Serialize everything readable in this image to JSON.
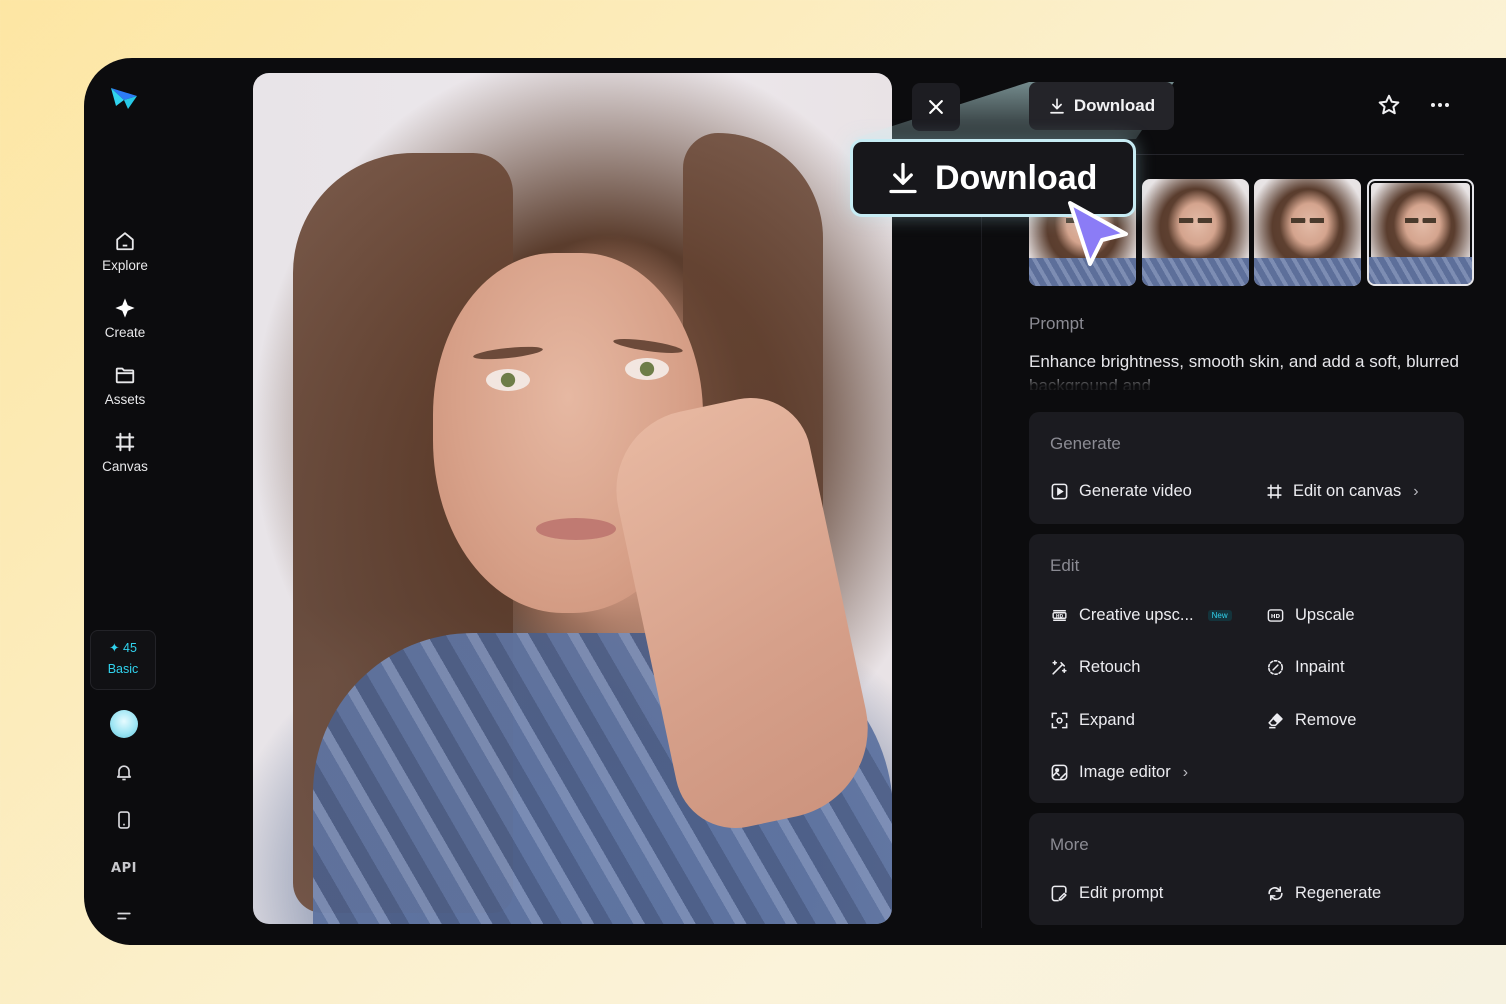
{
  "sidebar": {
    "nav": [
      {
        "label": "Explore",
        "icon": "home-icon"
      },
      {
        "label": "Create",
        "icon": "sparkle-icon"
      },
      {
        "label": "Assets",
        "icon": "folder-icon"
      },
      {
        "label": "Canvas",
        "icon": "canvas-icon"
      }
    ],
    "credits": {
      "amount": "45",
      "tier": "Basic"
    },
    "bottom": {
      "api_label": "API"
    }
  },
  "toolbar": {
    "download_label": "Download"
  },
  "callout": {
    "download_label": "Download"
  },
  "prompt": {
    "label": "Prompt",
    "text": "Enhance brightness, smooth skin, and add a soft, blurred background and"
  },
  "generate": {
    "title": "Generate",
    "actions": [
      {
        "label": "Generate video",
        "icon": "play-icon"
      },
      {
        "label": "Edit on canvas",
        "icon": "canvas-icon"
      }
    ]
  },
  "edit": {
    "title": "Edit",
    "actions": [
      {
        "label": "Creative upsc...",
        "icon": "hd-plus-icon",
        "badge": "New"
      },
      {
        "label": "Upscale",
        "icon": "hd-icon"
      },
      {
        "label": "Retouch",
        "icon": "wand-icon"
      },
      {
        "label": "Inpaint",
        "icon": "inpaint-icon"
      },
      {
        "label": "Expand",
        "icon": "expand-icon"
      },
      {
        "label": "Remove",
        "icon": "eraser-icon"
      },
      {
        "label": "Image editor",
        "icon": "image-editor-icon"
      }
    ]
  },
  "more": {
    "title": "More",
    "actions": [
      {
        "label": "Edit prompt",
        "icon": "edit-prompt-icon"
      },
      {
        "label": "Regenerate",
        "icon": "regenerate-icon"
      }
    ]
  },
  "colors": {
    "accent": "#31d3ee",
    "panel": "#1b1b20",
    "background": "#0c0c0e"
  }
}
